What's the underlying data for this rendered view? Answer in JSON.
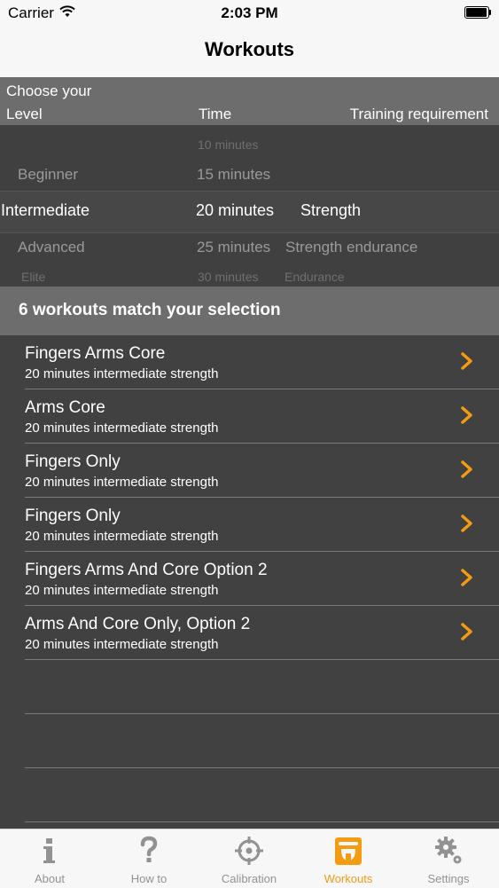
{
  "status_bar": {
    "carrier": "Carrier",
    "time": "2:03 PM"
  },
  "nav": {
    "title": "Workouts"
  },
  "picker_header": {
    "choose": "Choose your",
    "level": "Level",
    "time": "Time",
    "requirement": "Training requirement"
  },
  "picker": {
    "rows": [
      {
        "level": "",
        "time": "10 minutes",
        "requirement": ""
      },
      {
        "level": "Beginner",
        "time": "15 minutes",
        "requirement": ""
      },
      {
        "level": "Intermediate",
        "time": "20 minutes",
        "requirement": "Strength"
      },
      {
        "level": "Advanced",
        "time": "25 minutes",
        "requirement": "Strength endurance"
      },
      {
        "level": "Elite",
        "time": "30 minutes",
        "requirement": "Endurance"
      }
    ]
  },
  "match_banner": "6 workouts match your selection",
  "workouts": [
    {
      "title": "Fingers Arms Core",
      "subtitle": "20 minutes intermediate strength"
    },
    {
      "title": "Arms Core",
      "subtitle": "20 minutes intermediate strength"
    },
    {
      "title": "Fingers Only",
      "subtitle": "20 minutes intermediate strength"
    },
    {
      "title": "Fingers Only",
      "subtitle": "20 minutes intermediate strength"
    },
    {
      "title": "Fingers Arms And Core Option 2",
      "subtitle": "20 minutes intermediate strength"
    },
    {
      "title": "Arms And Core Only, Option 2",
      "subtitle": "20 minutes intermediate strength"
    }
  ],
  "tabs": [
    {
      "label": "About",
      "icon": "info-icon"
    },
    {
      "label": "How to",
      "icon": "question-icon"
    },
    {
      "label": "Calibration",
      "icon": "crosshair-icon"
    },
    {
      "label": "Workouts",
      "icon": "hangboard-icon",
      "active": true
    },
    {
      "label": "Settings",
      "icon": "gears-icon"
    }
  ],
  "colors": {
    "accent": "#f39c12",
    "background": "#414141",
    "header": "#6d6d6d"
  }
}
